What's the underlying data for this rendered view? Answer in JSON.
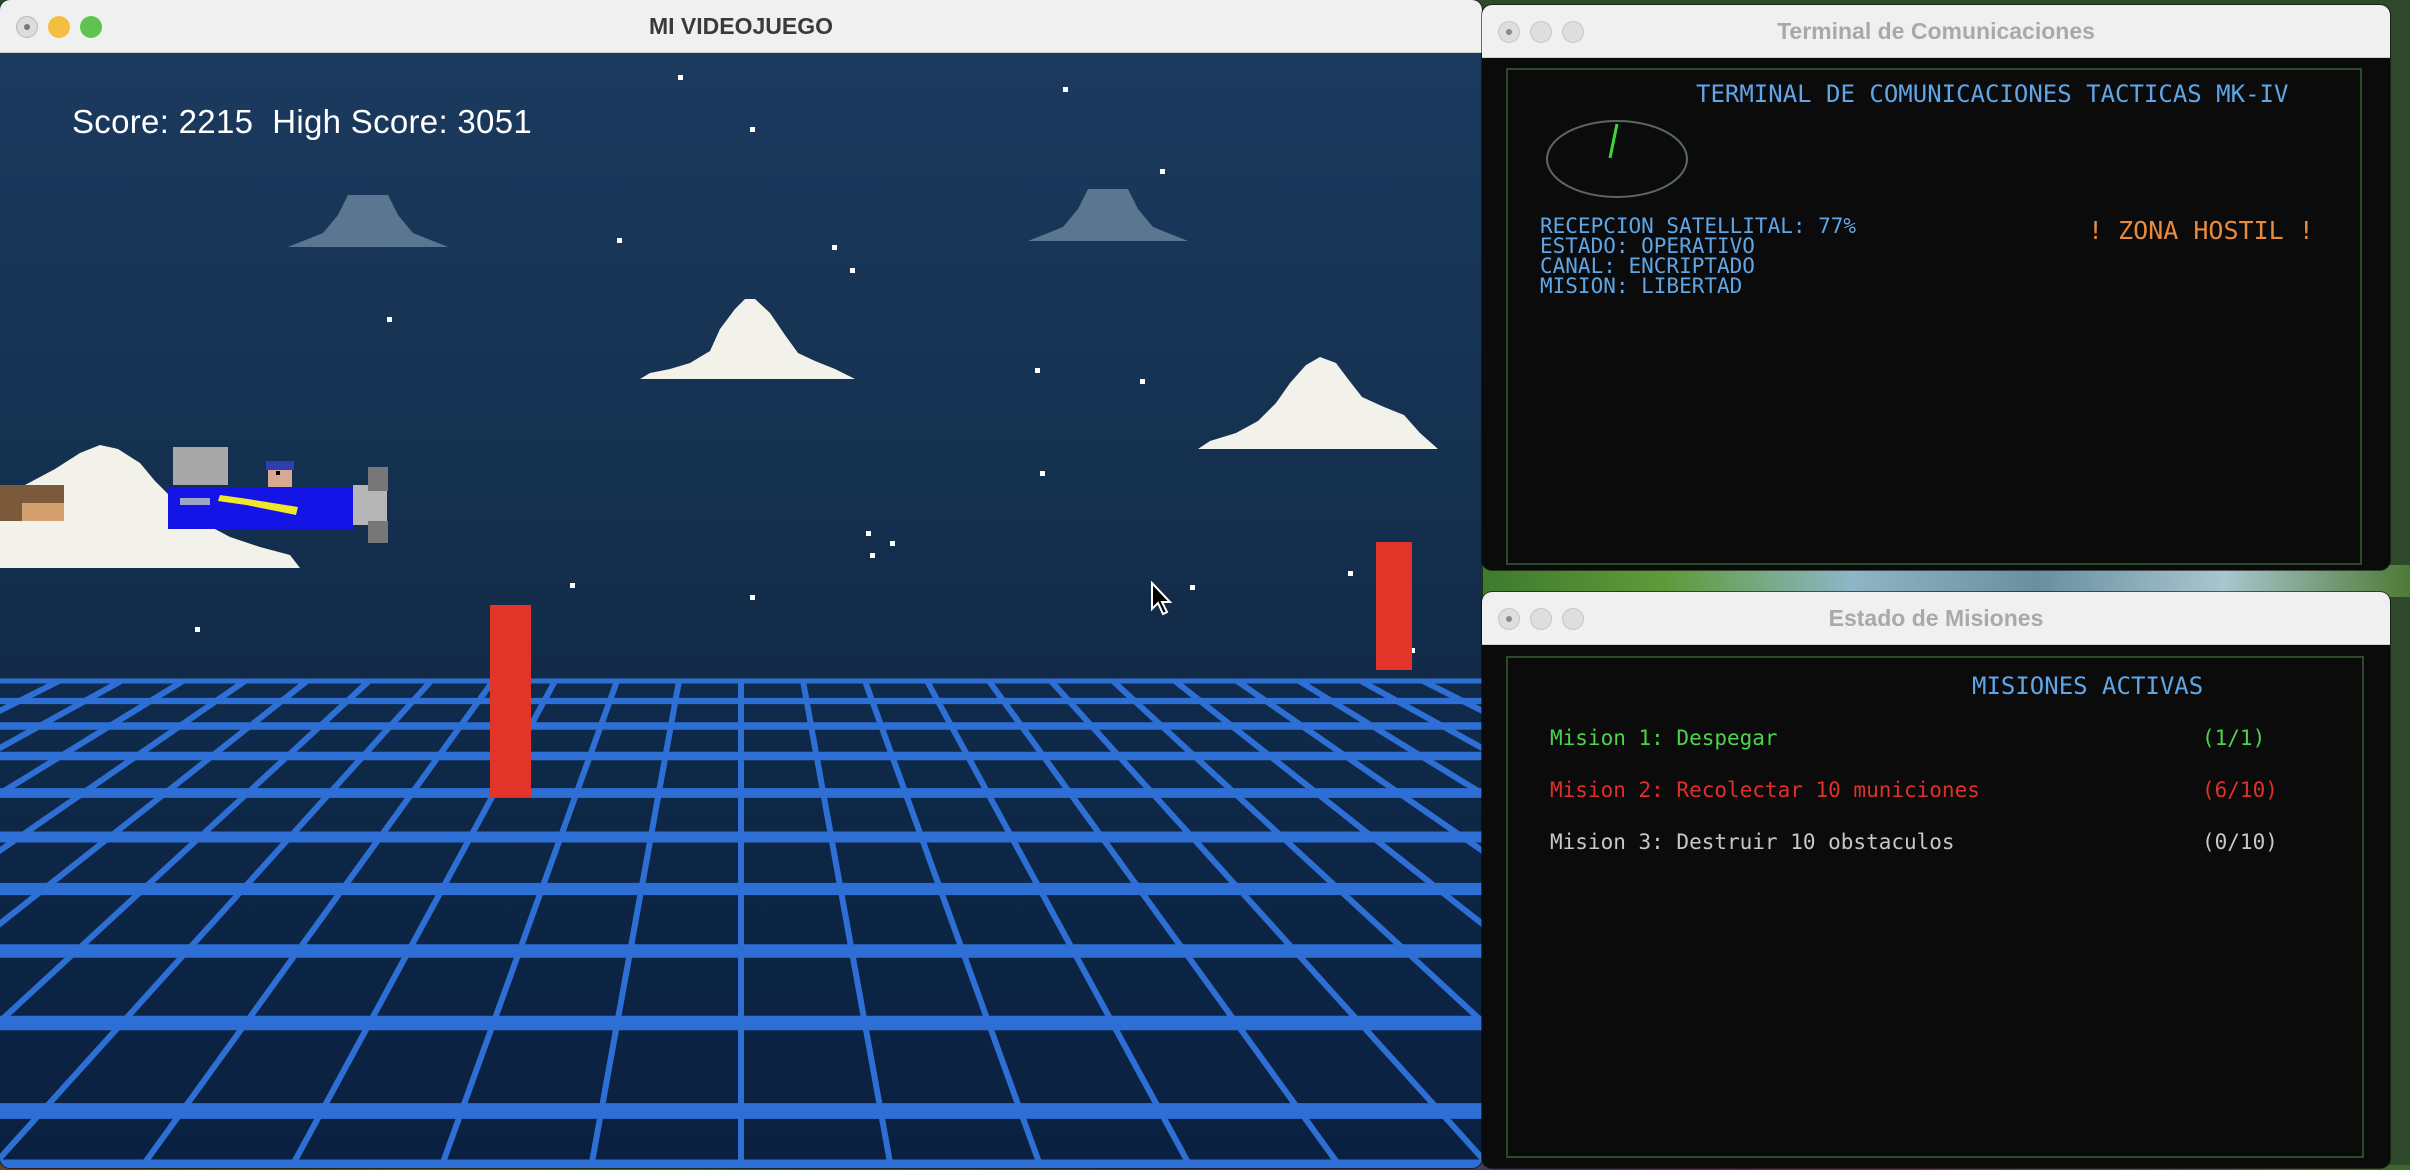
{
  "game_window": {
    "title": "MI VIDEOJUEGO",
    "score_label": "Score:",
    "score": 2215,
    "high_score_label": "High Score:",
    "high_score": 3051,
    "colors": {
      "sky": "#1b3a5e",
      "grid": "#2e6fd6",
      "obstacle": "#e3342a",
      "plane": "#1414e6"
    }
  },
  "terminal_window": {
    "title": "Terminal de Comunicaciones",
    "heading": "TERMINAL DE COMUNICACIONES TACTICAS MK-IV",
    "lines": [
      "RECEPCION SATELLITAL: 77%",
      "ESTADO: OPERATIVO",
      "CANAL: ENCRIPTADO",
      "MISION: LIBERTAD"
    ],
    "alert": "! ZONA HOSTIL !",
    "colors": {
      "text": "#5fa6e8",
      "alert": "#e88b3f",
      "radar_needle": "#3fd43f"
    }
  },
  "missions_window": {
    "title": "Estado de Misiones",
    "heading": "MISIONES ACTIVAS",
    "missions": [
      {
        "name": "Mision 1: Despegar",
        "progress": "(1/1)",
        "color": "#4cd44c"
      },
      {
        "name": "Mision 2: Recolectar 10 municiones",
        "progress": "(6/10)",
        "color": "#e0302a"
      },
      {
        "name": "Mision 3: Destruir 10 obstaculos",
        "progress": "(0/10)",
        "color": "#c8c8c8"
      }
    ]
  }
}
